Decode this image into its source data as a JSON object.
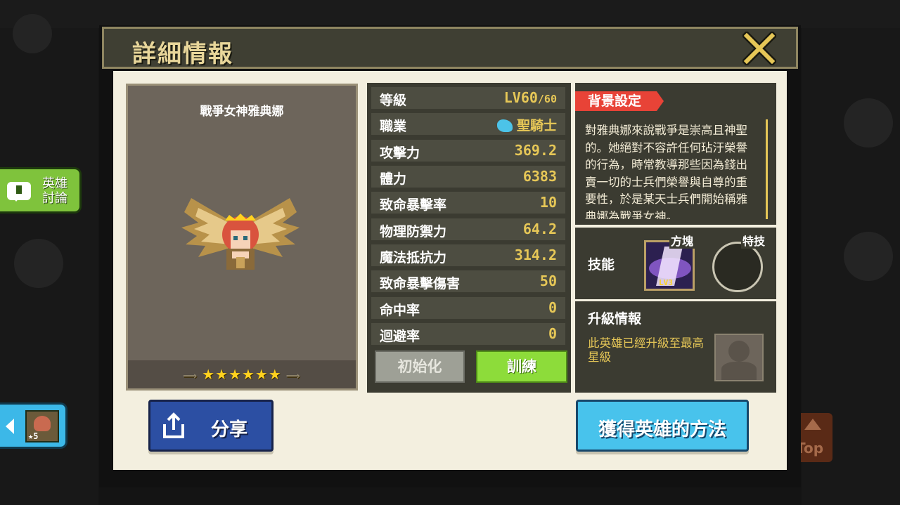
{
  "modal": {
    "title": "詳細情報"
  },
  "hero": {
    "name": "戰爭女神雅典娜",
    "stars": "★★★★★★"
  },
  "stats": [
    {
      "label": "等級",
      "value": "LV60",
      "suffix": "/60"
    },
    {
      "label": "職業",
      "value": "聖騎士"
    },
    {
      "label": "攻擊力",
      "value": "369.2"
    },
    {
      "label": "體力",
      "value": "6383"
    },
    {
      "label": "致命暴擊率",
      "value": "10"
    },
    {
      "label": "物理防禦力",
      "value": "64.2"
    },
    {
      "label": "魔法抵抗力",
      "value": "314.2"
    },
    {
      "label": "致命暴擊傷害",
      "value": "50"
    },
    {
      "label": "命中率",
      "value": "0"
    },
    {
      "label": "迴避率",
      "value": "0"
    }
  ],
  "buttons": {
    "reset": "初始化",
    "train": "訓練",
    "share": "分享",
    "obtain": "獲得英雄的方法"
  },
  "background": {
    "tag": "背景設定",
    "text": "對雅典娜來說戰爭是崇高且神聖的。她絕對不容許任何玷汙榮譽的行為，時常教導那些因為錢出賣一切的士兵們榮譽與自尊的重要性，於是某天士兵們開始稱雅典娜為戰爭女神。"
  },
  "skills": {
    "label": "技能",
    "skill1_tag": "方塊",
    "skill1_level": "LV3",
    "skill2_tag": "特技"
  },
  "upgrade": {
    "label": "升級情報",
    "text": "此英雄已經升級至最高星級"
  },
  "side": {
    "discuss_label": "英雄討論",
    "hero_stars": "★5",
    "top_label": "Top"
  },
  "colors": {
    "title_text": "#e8d69a",
    "value_gold": "#e6c757",
    "tag_red": "#e84337",
    "train_green": "#8ddc3a",
    "share_blue": "#2c4fa3",
    "obtain_cyan": "#48c3ec"
  }
}
